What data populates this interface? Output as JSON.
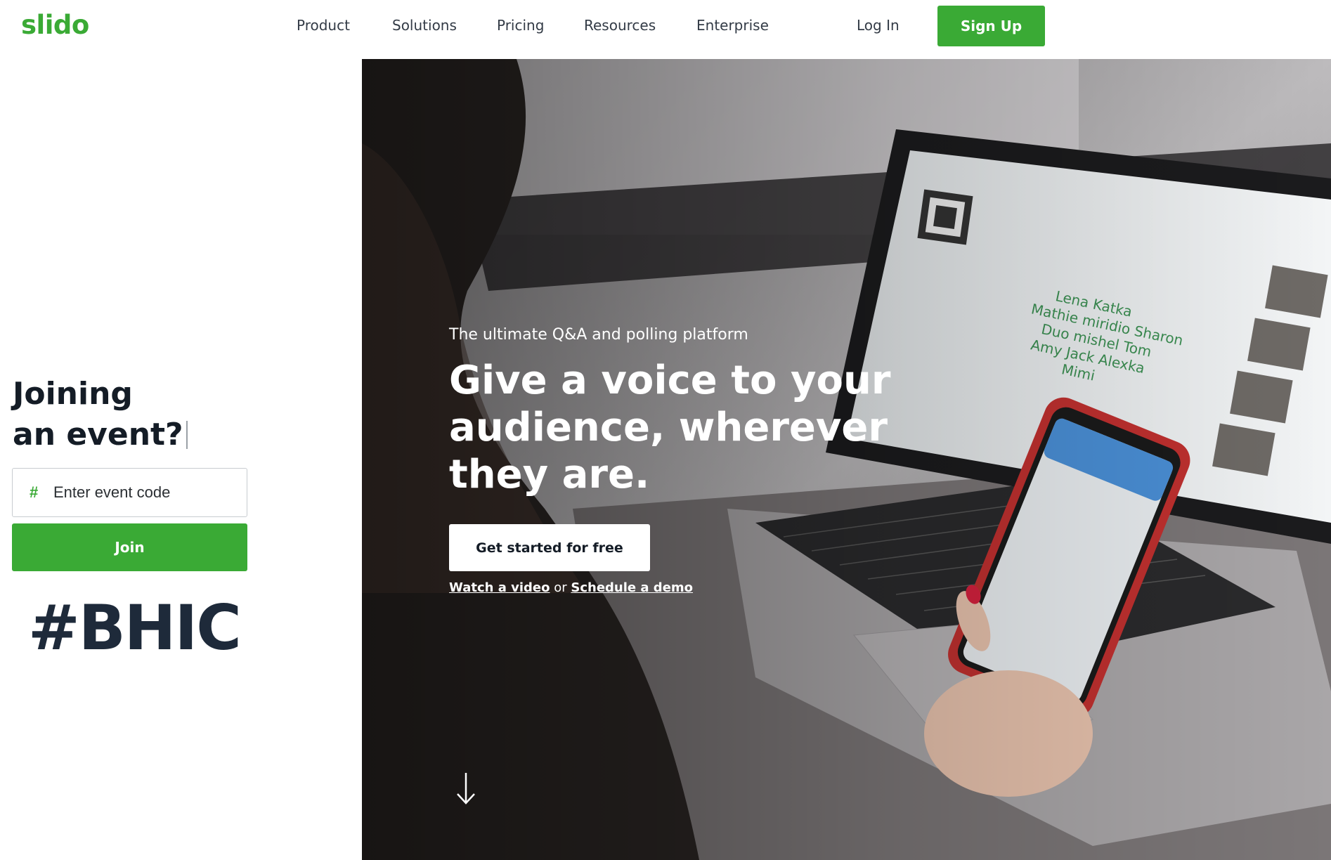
{
  "header": {
    "logo": "slido",
    "nav": [
      "Product",
      "Solutions",
      "Pricing",
      "Resources",
      "Enterprise"
    ],
    "login_label": "Log In",
    "signup_label": "Sign Up"
  },
  "join_panel": {
    "title_line1": "Joining",
    "title_line2": "an event?",
    "code_placeholder": "Enter event code",
    "join_label": "Join",
    "event_tag": "#BHIC"
  },
  "hero": {
    "tagline": "The ultimate Q&A and polling platform",
    "headline_line1": "Give a voice to your",
    "headline_line2": "audience, wherever",
    "headline_line3": "they are.",
    "cta_label": "Get started for free",
    "watch_link": "Watch a video",
    "link_separator": "or",
    "demo_link": "Schedule a demo"
  },
  "icons": {
    "hash": "hash-icon",
    "scroll_down": "arrow-down-icon"
  },
  "colors": {
    "brand_green": "#3aaa35",
    "text_dark": "#141c26",
    "tag_navy": "#1e2a3a"
  }
}
